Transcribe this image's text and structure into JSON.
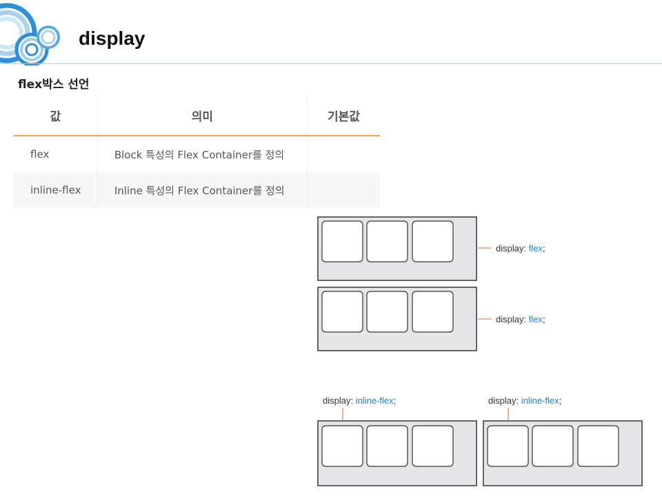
{
  "slide": {
    "title": "display",
    "subtitle": "flex박스 선언"
  },
  "table": {
    "headers": [
      "값",
      "의미",
      "기본값"
    ],
    "rows": [
      [
        "flex",
        "Block 특성의 Flex Container를 정의",
        ""
      ],
      [
        "inline-flex",
        "Inline 특성의 Flex Container를 정의",
        ""
      ]
    ]
  },
  "diagram": {
    "block_label_prefix": "display: ",
    "block_label_value": "flex",
    "block_label_suffix": ";",
    "inline_label_prefix": "display: ",
    "inline_label_value": "inline-flex",
    "inline_label_suffix": ";",
    "colors": {
      "keyword": "#1e7fd0",
      "pointer": "#e8836a",
      "container_fill": "#e6e6e8"
    }
  }
}
